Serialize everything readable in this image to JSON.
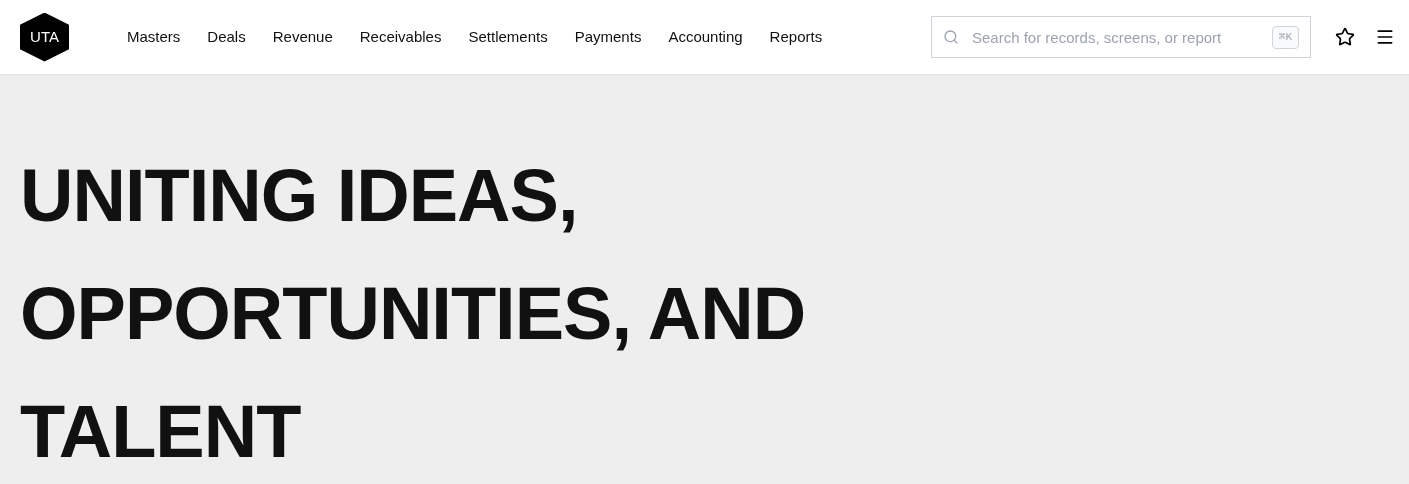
{
  "logo": {
    "text": "UTA"
  },
  "nav": [
    {
      "label": "Masters"
    },
    {
      "label": "Deals"
    },
    {
      "label": "Revenue"
    },
    {
      "label": "Receivables"
    },
    {
      "label": "Settlements"
    },
    {
      "label": "Payments"
    },
    {
      "label": "Accounting"
    },
    {
      "label": "Reports"
    }
  ],
  "search": {
    "placeholder": "Search for records, screens, or report",
    "shortcut": "⌘K"
  },
  "hero": {
    "lines": [
      "UNITING IDEAS,",
      "OPPORTUNITIES, AND",
      "TALENT"
    ]
  }
}
